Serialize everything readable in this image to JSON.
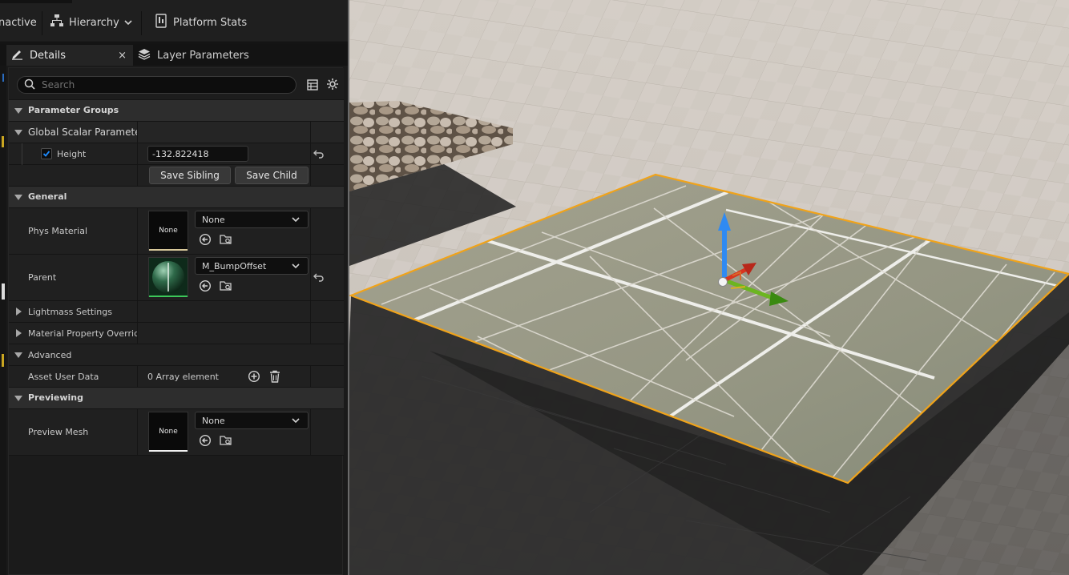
{
  "toolbar": {
    "inactive_label": "nactive",
    "hierarchy_label": "Hierarchy",
    "platform_stats_label": "Platform Stats"
  },
  "tabs": {
    "details_label": "Details",
    "details_close": "×",
    "layer_params_label": "Layer Parameters"
  },
  "search": {
    "placeholder": "Search"
  },
  "details": {
    "parameter_groups": "Parameter Groups",
    "global_scalar": "Global Scalar Paramete",
    "height": {
      "label": "Height",
      "checked": true,
      "value": "-132.822418"
    },
    "save_sibling": "Save Sibling",
    "save_child": "Save Child",
    "general": "General",
    "phys_material": {
      "label": "Phys Material",
      "thumb_text": "None",
      "value": "None"
    },
    "parent": {
      "label": "Parent",
      "value": "M_BumpOffset"
    },
    "lightmass": "Lightmass Settings",
    "material_overrides": "Material Property Override:",
    "advanced": "Advanced",
    "asset_user_data": {
      "label": "Asset User Data",
      "value": "0 Array element"
    },
    "previewing": "Previewing",
    "preview_mesh": {
      "label": "Preview Mesh",
      "thumb_text": "None",
      "value": "None"
    }
  },
  "colors": {
    "accent_selection": "#f0a31a",
    "checkbox_blue": "#1e8cff",
    "gizmo_x": "#6cb520",
    "gizmo_y": "#2f8af2",
    "gizmo_z": "#d8351f"
  }
}
